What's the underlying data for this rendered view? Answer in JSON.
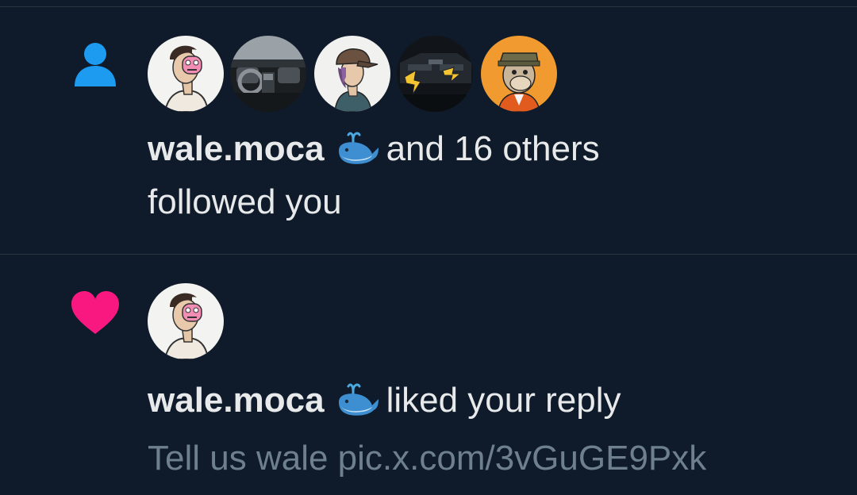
{
  "notifications": [
    {
      "type": "follow",
      "icon": "person-icon",
      "icon_color": "#1d9bf0",
      "avatars": [
        {
          "name": "avatar-wale-moca",
          "theme": "pink-mask"
        },
        {
          "name": "avatar-car-interior",
          "theme": "car"
        },
        {
          "name": "avatar-cap-person",
          "theme": "cap"
        },
        {
          "name": "avatar-dark-car-art",
          "theme": "dark-car"
        },
        {
          "name": "avatar-bored-ape",
          "theme": "ape"
        }
      ],
      "actor_name": "wale.moca",
      "actor_badge": "whale-emoji",
      "rest_line1": "and 16 others",
      "line2": "followed you"
    },
    {
      "type": "like",
      "icon": "heart-icon",
      "icon_color": "#f91880",
      "avatars": [
        {
          "name": "avatar-wale-moca",
          "theme": "pink-mask"
        }
      ],
      "actor_name": "wale.moca",
      "actor_badge": "whale-emoji",
      "action": "liked your reply",
      "snippet": "Tell us wale pic.x.com/3vGuGE9Pxk"
    }
  ]
}
